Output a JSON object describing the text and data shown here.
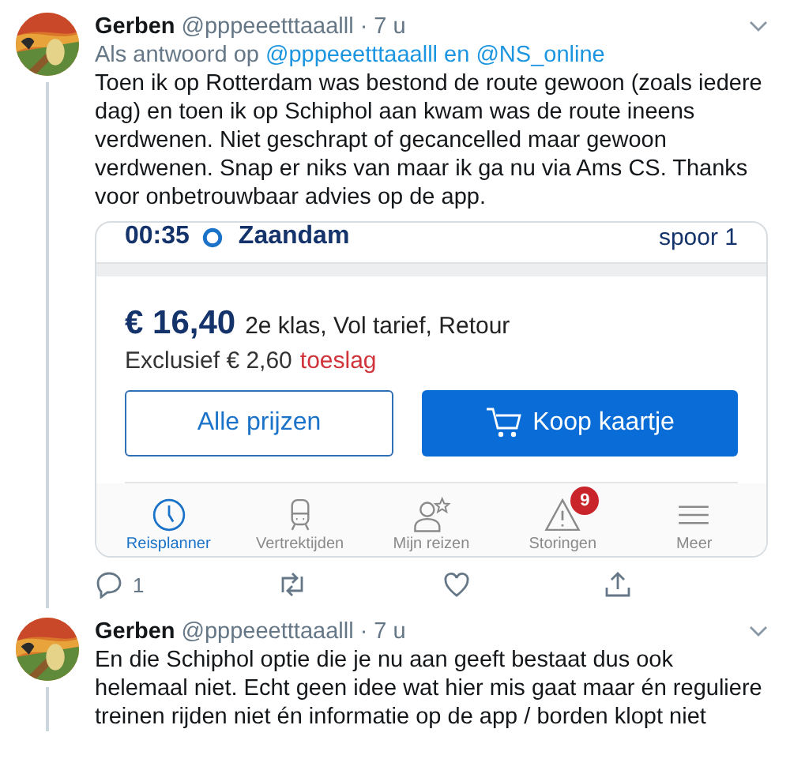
{
  "tweets": [
    {
      "name": "Gerben",
      "handle": "@pppeeetttaaalll",
      "separator": "·",
      "time": "7 u",
      "reply_prefix": "Als antwoord op",
      "reply_to": "@pppeeetttaaalll en @NS_online",
      "text": "Toen ik op Rotterdam was bestond de route gewoon (zoals iedere dag) en toen ik op Schiphol aan kwam was de route ineens verdwenen. Niet geschrapt of gecancelled maar gewoon verdwenen. Snap er niks van maar ik ga nu via Ams CS. Thanks voor onbetrouwbaar advies op de app.",
      "attachment": {
        "departure": {
          "time": "00:35",
          "station": "Zaandam",
          "platform": "spoor 1"
        },
        "price": "€ 16,40",
        "fare": "2e klas, Vol tarief, Retour",
        "surcharge": "Exclusief € 2,60",
        "surcharge_link": "toeslag",
        "buttons": [
          {
            "label": "Alle prijzen",
            "kind": "outline"
          },
          {
            "label": "Koop kaartje",
            "kind": "primary"
          }
        ],
        "tabs": [
          {
            "label": "Reisplanner",
            "kind": "clock",
            "selected": true
          },
          {
            "label": "Vertrektijden",
            "kind": "train",
            "selected": false
          },
          {
            "label": "Mijn reizen",
            "kind": "person",
            "selected": false
          },
          {
            "label": "Storingen",
            "kind": "warning",
            "selected": false,
            "badge": "9"
          },
          {
            "label": "Meer",
            "kind": "menu",
            "selected": false
          }
        ]
      },
      "reply_count": "1"
    },
    {
      "name": "Gerben",
      "handle": "@pppeeetttaaalll",
      "separator": "·",
      "time": "7 u",
      "text": "En die Schiphol optie die je nu aan geeft bestaat dus ook helemaal niet. Echt geen idee wat hier mis gaat maar én reguliere treinen rijden niet én informatie op de app / borden klopt niet"
    }
  ]
}
